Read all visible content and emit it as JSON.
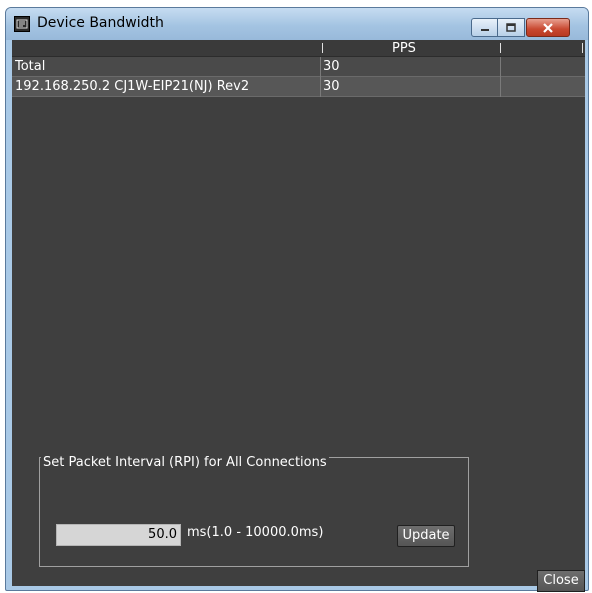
{
  "window": {
    "title": "Device Bandwidth",
    "controls": {
      "minimize": "minimize",
      "maximize": "maximize",
      "close": "close"
    }
  },
  "grid": {
    "columns": [
      "",
      "PPS",
      ""
    ],
    "rows": [
      {
        "name": "Total",
        "pps": "30"
      },
      {
        "name": "192.168.250.2 CJ1W-EIP21(NJ) Rev2",
        "pps": "30"
      }
    ]
  },
  "rpi": {
    "group_label": "Set Packet Interval (RPI) for All Connections",
    "value": "50.0",
    "unit_range": "ms(1.0 - 10000.0ms)",
    "update_label": "Update"
  },
  "footer": {
    "close_label": "Close"
  },
  "colors": {
    "title_bar": "#a4c4e2",
    "client_bg": "#3f3f3f",
    "close_accent": "#c84830"
  }
}
